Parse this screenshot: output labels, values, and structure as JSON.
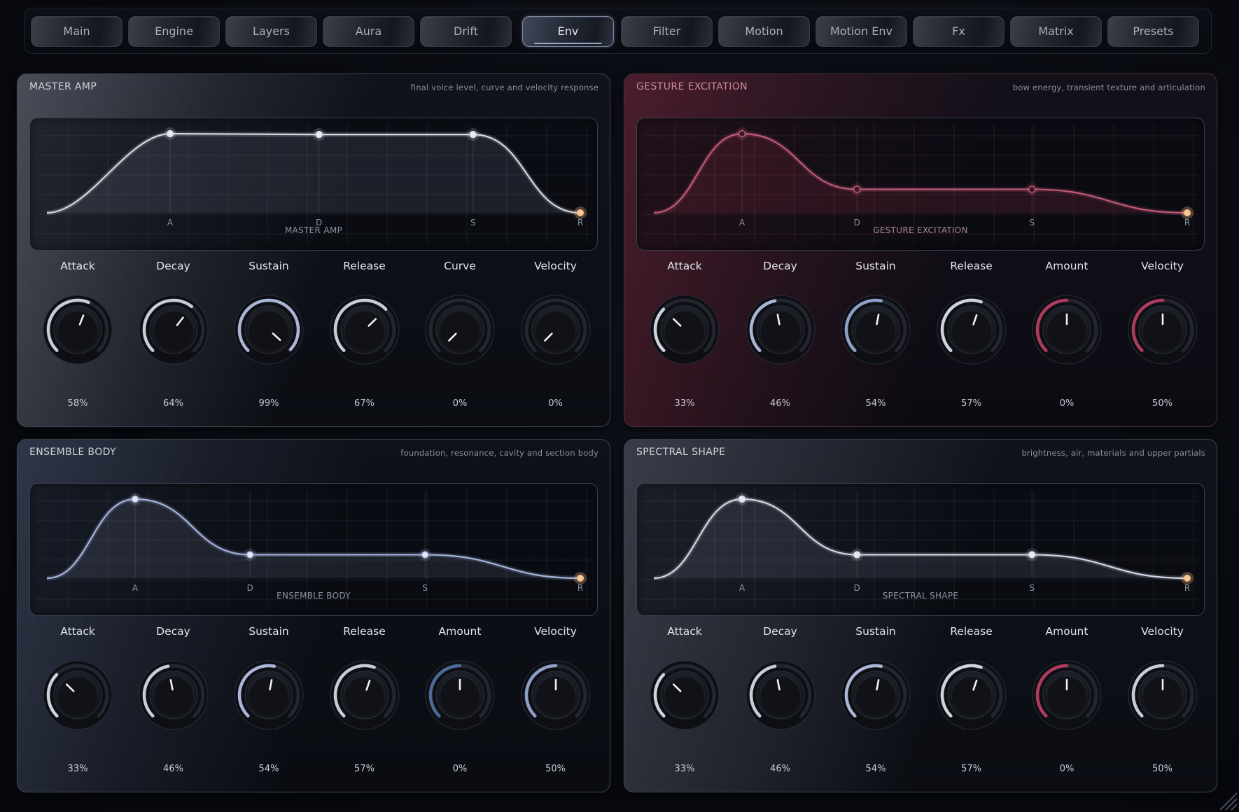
{
  "tabs": [
    {
      "label": "Main",
      "active": false
    },
    {
      "label": "Engine",
      "active": false
    },
    {
      "label": "Layers",
      "active": false
    },
    {
      "label": "Aura",
      "active": false
    },
    {
      "label": "Drift",
      "active": false
    },
    {
      "label": "Env",
      "active": true
    },
    {
      "label": "Filter",
      "active": false
    },
    {
      "label": "Motion",
      "active": false
    },
    {
      "label": "Motion Env",
      "active": false
    },
    {
      "label": "Fx",
      "active": false
    },
    {
      "label": "Matrix",
      "active": false
    },
    {
      "label": "Presets",
      "active": false
    }
  ],
  "panels": [
    {
      "id": "master-amp",
      "title": "MASTER AMP",
      "subtitle": "final voice level, curve and velocity response",
      "env_label": "MASTER AMP",
      "theme": "gray",
      "accent": "#d4d8e2",
      "stages": [
        "A",
        "D",
        "S",
        "R"
      ],
      "envelope": {
        "attack": 0.58,
        "decay": 0.64,
        "sustain": 0.99,
        "release": 0.67
      },
      "knobs": [
        {
          "label": "Attack",
          "value": "58%",
          "fraction": 0.58,
          "arc": "#c9ccd6",
          "bipolar": false
        },
        {
          "label": "Decay",
          "value": "64%",
          "fraction": 0.64,
          "arc": "#c9ccd6",
          "bipolar": false
        },
        {
          "label": "Sustain",
          "value": "99%",
          "fraction": 0.99,
          "arc": "#a9b6d6",
          "bipolar": false
        },
        {
          "label": "Release",
          "value": "67%",
          "fraction": 0.67,
          "arc": "#c9ccd6",
          "bipolar": false
        },
        {
          "label": "Curve",
          "value": "0%",
          "fraction": 0.0,
          "arc": "#b03a5c",
          "bipolar": true
        },
        {
          "label": "Velocity",
          "value": "0%",
          "fraction": 0.0,
          "arc": "#c9ccd6",
          "bipolar": false
        }
      ]
    },
    {
      "id": "gesture-excitation",
      "title": "GESTURE EXCITATION",
      "subtitle": "bow energy, transient texture and articulation",
      "env_label": "GESTURE EXCITATION",
      "theme": "red",
      "accent": "#c05a78",
      "stages": [
        "A",
        "D",
        "S",
        "R"
      ],
      "envelope": {
        "attack": 0.33,
        "decay": 0.46,
        "sustain": 0.54,
        "release": 0.57
      },
      "knobs": [
        {
          "label": "Attack",
          "value": "33%",
          "fraction": 0.33,
          "arc": "#d0d3dc",
          "bipolar": false
        },
        {
          "label": "Decay",
          "value": "46%",
          "fraction": 0.46,
          "arc": "#a9b6d6",
          "bipolar": false
        },
        {
          "label": "Sustain",
          "value": "54%",
          "fraction": 0.54,
          "arc": "#8ea0c8",
          "bipolar": false
        },
        {
          "label": "Release",
          "value": "57%",
          "fraction": 0.57,
          "arc": "#d0d3dc",
          "bipolar": false
        },
        {
          "label": "Amount",
          "value": "0%",
          "fraction": 0.5,
          "arc": "#b03a5c",
          "bipolar": false
        },
        {
          "label": "Velocity",
          "value": "50%",
          "fraction": 0.5,
          "arc": "#b03a5c",
          "bipolar": false
        }
      ]
    },
    {
      "id": "ensemble-body",
      "title": "ENSEMBLE BODY",
      "subtitle": "foundation, resonance, cavity and section body",
      "env_label": "ENSEMBLE BODY",
      "theme": "blue",
      "accent": "#a4b4dc",
      "stages": [
        "A",
        "D",
        "S",
        "R"
      ],
      "envelope": {
        "attack": 0.33,
        "decay": 0.46,
        "sustain": 0.54,
        "release": 0.57
      },
      "knobs": [
        {
          "label": "Attack",
          "value": "33%",
          "fraction": 0.33,
          "arc": "#d0d3dc",
          "bipolar": false
        },
        {
          "label": "Decay",
          "value": "46%",
          "fraction": 0.46,
          "arc": "#c9ccd6",
          "bipolar": false
        },
        {
          "label": "Sustain",
          "value": "54%",
          "fraction": 0.54,
          "arc": "#a9b6d6",
          "bipolar": false
        },
        {
          "label": "Release",
          "value": "57%",
          "fraction": 0.57,
          "arc": "#c9ccd6",
          "bipolar": false
        },
        {
          "label": "Amount",
          "value": "0%",
          "fraction": 0.5,
          "arc": "#4e6a9a",
          "bipolar": false
        },
        {
          "label": "Velocity",
          "value": "50%",
          "fraction": 0.5,
          "arc": "#8ea0c8",
          "bipolar": false
        }
      ]
    },
    {
      "id": "spectral-shape",
      "title": "SPECTRAL SHAPE",
      "subtitle": "brightness, air, materials and upper partials",
      "env_label": "SPECTRAL SHAPE",
      "theme": "gray2",
      "accent": "#d4d8e6",
      "stages": [
        "A",
        "D",
        "S",
        "R"
      ],
      "envelope": {
        "attack": 0.33,
        "decay": 0.46,
        "sustain": 0.54,
        "release": 0.57
      },
      "knobs": [
        {
          "label": "Attack",
          "value": "33%",
          "fraction": 0.33,
          "arc": "#d0d3dc",
          "bipolar": false
        },
        {
          "label": "Decay",
          "value": "46%",
          "fraction": 0.46,
          "arc": "#c9ccd6",
          "bipolar": false
        },
        {
          "label": "Sustain",
          "value": "54%",
          "fraction": 0.54,
          "arc": "#a9b6d6",
          "bipolar": false
        },
        {
          "label": "Release",
          "value": "57%",
          "fraction": 0.57,
          "arc": "#d0d3dc",
          "bipolar": false
        },
        {
          "label": "Amount",
          "value": "0%",
          "fraction": 0.5,
          "arc": "#b03a5c",
          "bipolar": false
        },
        {
          "label": "Velocity",
          "value": "50%",
          "fraction": 0.5,
          "arc": "#c9ccd6",
          "bipolar": false
        }
      ]
    }
  ]
}
